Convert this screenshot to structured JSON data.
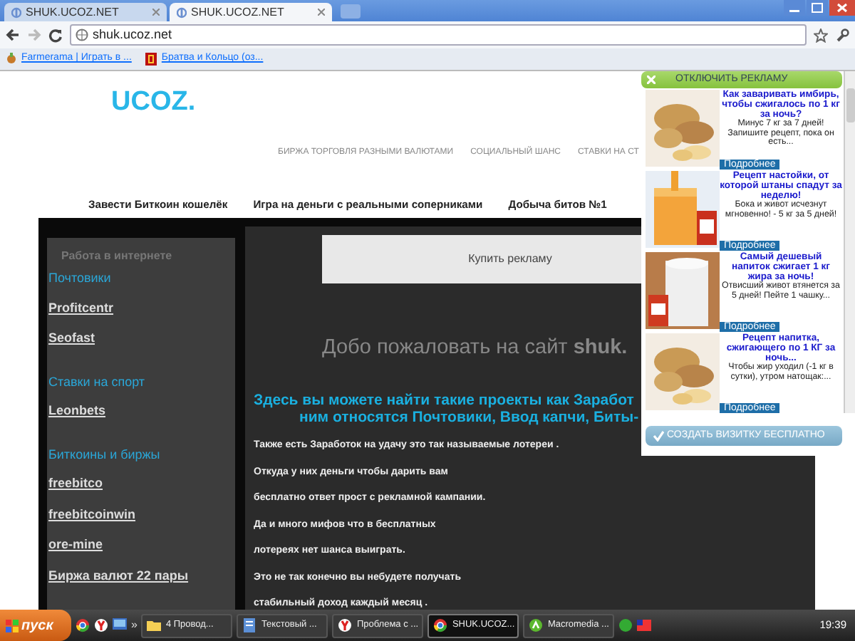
{
  "browser": {
    "tabs": [
      {
        "title": "SHUK.UCOZ.NET",
        "selected": false
      },
      {
        "title": "SHUK.UCOZ.NET",
        "selected": true
      }
    ],
    "url": "shuk.ucoz.net",
    "bookmarks": [
      {
        "label": "Farmerama | Играть в ..."
      },
      {
        "label": "Братва и Кольцо (оз..."
      }
    ]
  },
  "site": {
    "logo": "UCOZ.",
    "top_nav": [
      "БИРЖА ТОРГОВЛЯ РАЗНЫМИ ВАЛЮТАМИ",
      "СОЦИАЛЬНЫЙ ШАНС",
      "СТАВКИ НА СТ"
    ],
    "menu": [
      "Завести Биткоин кошелёк",
      "Игра на деньги с реальными соперниками",
      "Добыча битов №1"
    ],
    "sidebar": {
      "title": "Работа в интернете",
      "groups": [
        {
          "heading": "Почтовики",
          "links": [
            "Profitcentr",
            "Seofast"
          ]
        },
        {
          "heading": "Ставки на спорт",
          "links": [
            "Leonbets"
          ]
        },
        {
          "heading": "Биткоины и биржы",
          "links": [
            "freebitco",
            "freebitcoinwin",
            "ore-mine",
            "Биржа валют 22 пары"
          ]
        }
      ]
    },
    "main": {
      "ad_button": "Купить рекламу",
      "welcome": "Добо пожаловать на сайт **shuk.**",
      "heading_lines": [
        "Здесь вы можете найти такие проекты как Заработ",
        "ним относятся Почтовики, Ввод капчи, Биты-"
      ],
      "paragraphs": [
        "Также есть Заработок на удачу это так называемые лотереи .",
        "Откуда у них деньги чтобы дарить вам",
        "бесплатно ответ прост с рекламной кампании.",
        "Да и много мифов что в бесплатных",
        "лотереях нет шанса выиграть.",
        "Это не так конечно вы небудете получать",
        "стабильный доход каждый месяц ."
      ]
    }
  },
  "ads": {
    "close_label": "ОТКЛЮЧИТЬ РЕКЛАМУ",
    "items": [
      {
        "title": "Как заваривать имбирь, чтобы сжигалось по 1 кг за ночь?",
        "text": "Минус 7 кг за 7 дней! Запишите рецепт, пока он есть...",
        "button": "Подробнее"
      },
      {
        "title": "Рецепт настойки, от которой штаны спадут за неделю!",
        "text": "Бока и живот исчезнут мгновенно! - 5 кг за 5 дней!",
        "button": "Подробнее"
      },
      {
        "title": "Самый дешевый напиток сжигает 1 кг жира за ночь!",
        "text": "Отвисший живот втянется за 5 дней! Пейте 1 чашку...",
        "button": "Подробнее"
      },
      {
        "title": "Рецепт напитка, сжигающего по 1 КГ за ночь...",
        "text": "Чтобы жир уходил (-1 кг в сутки), утром натощак:...",
        "button": "Подробнее"
      }
    ],
    "footer": "СОЗДАТЬ ВИЗИТКУ БЕСПЛАТНО"
  },
  "taskbar": {
    "start": "пуск",
    "more": "»",
    "tasks": [
      {
        "label": "4 Провод...",
        "selected": false
      },
      {
        "label": "Текстовый ...",
        "selected": false
      },
      {
        "label": "Проблема с ...",
        "selected": false
      },
      {
        "label": "SHUK.UCOZ...",
        "selected": true
      },
      {
        "label": "Macromedia ...",
        "selected": false
      }
    ],
    "clock": "19:39"
  }
}
